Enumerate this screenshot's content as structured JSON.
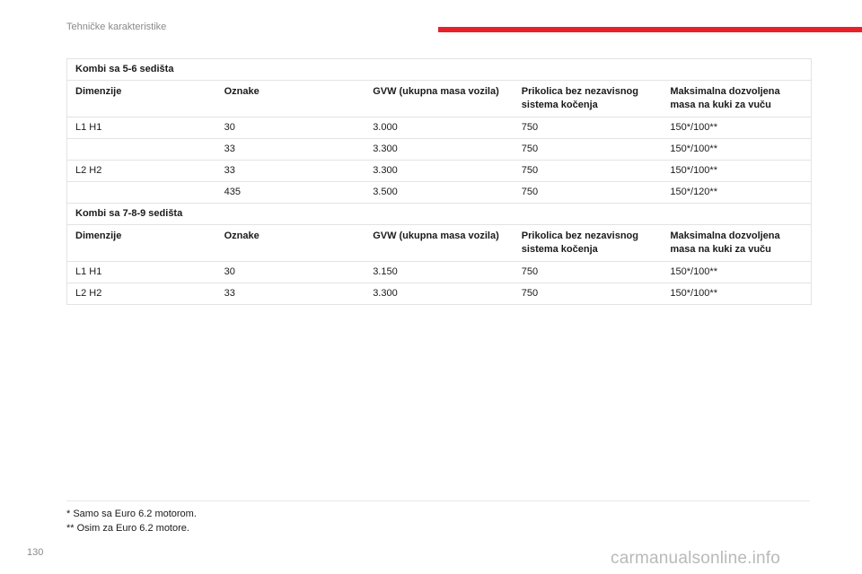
{
  "header": {
    "title": "Tehničke karakteristike",
    "accent_color": "#e8202a"
  },
  "tables": [
    {
      "caption": "Kombi sa 5-6 sedišta",
      "columns": [
        "Dimenzije",
        "Oznake",
        "GVW (ukupna masa vozila)",
        "Prikolica bez nezavisnog sistema kočenja",
        "Maksimalna dozvoljena masa na kuki za vuču"
      ],
      "rows": [
        [
          "L1 H1",
          "30",
          "3.000",
          "750",
          "150*/100**"
        ],
        [
          "",
          "33",
          "3.300",
          "750",
          "150*/100**"
        ],
        [
          "L2 H2",
          "33",
          "3.300",
          "750",
          "150*/100**"
        ],
        [
          "",
          "435",
          "3.500",
          "750",
          "150*/120**"
        ]
      ]
    },
    {
      "caption": "Kombi sa 7-8-9 sedišta",
      "columns": [
        "Dimenzije",
        "Oznake",
        "GVW (ukupna masa vozila)",
        "Prikolica bez nezavisnog sistema kočenja",
        "Maksimalna dozvoljena masa na kuki za vuču"
      ],
      "rows": [
        [
          "L1 H1",
          "30",
          "3.150",
          "750",
          "150*/100**"
        ],
        [
          "L2 H2",
          "33",
          "3.300",
          "750",
          "150*/100**"
        ]
      ]
    }
  ],
  "footnotes": [
    "* Samo sa Euro 6.2 motorom.",
    "** Osim za Euro 6.2 motore."
  ],
  "page_number": "130",
  "watermark": "carmanualsonline.info"
}
